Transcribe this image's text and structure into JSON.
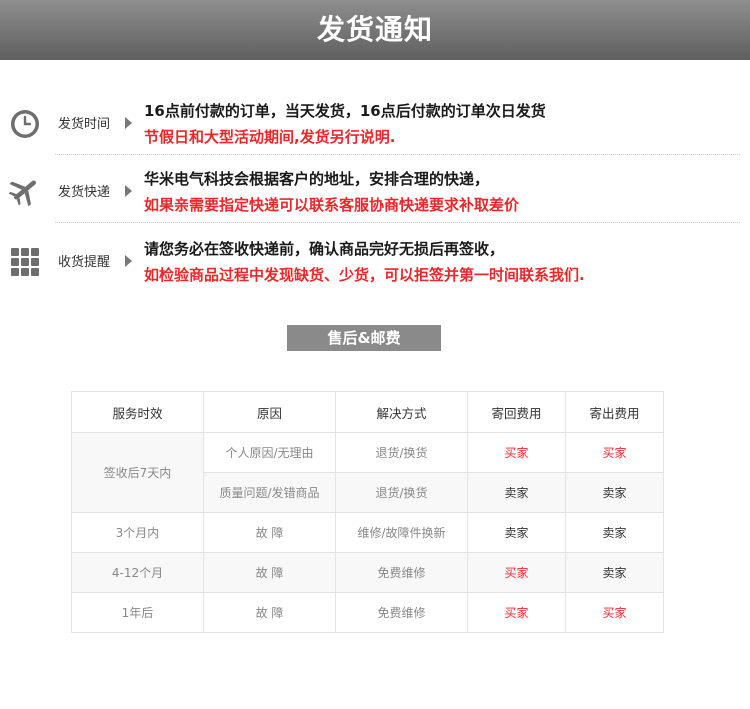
{
  "banner": {
    "title": "发货通知"
  },
  "info": [
    {
      "tag": "发货时间",
      "icon": "clock-icon",
      "line1": "16点前付款的订单，当天发货，16点后付款的订单次日发货",
      "line2": "节假日和大型活动期间,发货另行说明."
    },
    {
      "tag": "发货快递",
      "icon": "airplane-icon",
      "line1": "华米电气科技会根据客户的地址，安排合理的快递，",
      "line2": "如果亲需要指定快递可以联系客服协商快递要求补取差价"
    },
    {
      "tag": "收货提醒",
      "icon": "grid-icon",
      "line1": "请您务必在签收快递前，确认商品完好无损后再签收，",
      "line2": "如检验商品过程中发现缺货、少货，可以拒签并第一时间联系我们."
    }
  ],
  "section": {
    "title": "售后&邮费"
  },
  "table": {
    "headers": [
      "服务时效",
      "原因",
      "解决方式",
      "寄回费用",
      "寄出费用"
    ],
    "rows": [
      {
        "period": "签收后7天内",
        "reason": "个人原因/无理由",
        "solution": "退货/换货",
        "return_fee": "买家",
        "send_fee": "买家"
      },
      {
        "period": "",
        "reason": "质量问题/发错商品",
        "solution": "退货/换货",
        "return_fee": "卖家",
        "send_fee": "卖家"
      },
      {
        "period": "3个月内",
        "reason": "故 障",
        "solution": "维修/故障件换新",
        "return_fee": "卖家",
        "send_fee": "卖家"
      },
      {
        "period": "4-12个月",
        "reason": "故 障",
        "solution": "免费维修",
        "return_fee": "买家",
        "send_fee": "卖家"
      },
      {
        "period": "1年后",
        "reason": "故 障",
        "solution": "免费维修",
        "return_fee": "买家",
        "send_fee": "买家"
      }
    ]
  },
  "colors": {
    "banner": "#707070",
    "red": "#e8292c",
    "section_bg": "#8a8a8a"
  }
}
